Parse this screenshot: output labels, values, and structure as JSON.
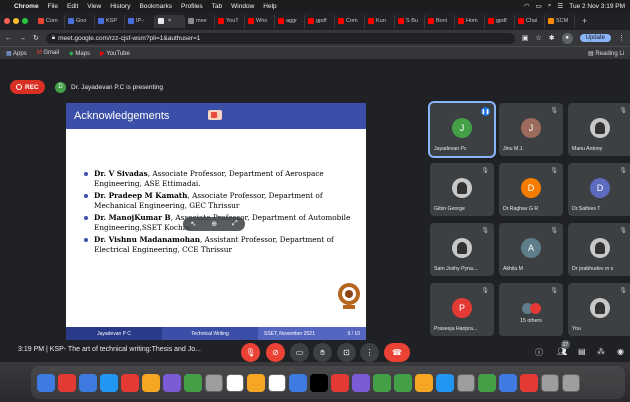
{
  "menubar": {
    "apple": "",
    "app": "Chrome",
    "items": [
      "File",
      "Edit",
      "View",
      "History",
      "Bookmarks",
      "Profiles",
      "Tab",
      "Window",
      "Help"
    ],
    "clock": "Tue 2 Nov  3:19 PM"
  },
  "tabs": [
    {
      "label": "Com",
      "color": "#ea4335"
    },
    {
      "label": "Goo",
      "color": "#4a6ee0"
    },
    {
      "label": "KSP",
      "color": "#4a6ee0"
    },
    {
      "label": "IP-:",
      "color": "#4a6ee0"
    },
    {
      "label": "",
      "color": "#e8eaed",
      "active": true
    },
    {
      "label": "mee",
      "color": "#888"
    },
    {
      "label": "YouT",
      "color": "#ff0000"
    },
    {
      "label": "Who",
      "color": "#ff0000"
    },
    {
      "label": "aggr",
      "color": "#ff0000"
    },
    {
      "label": "gpdf",
      "color": "#ff0000"
    },
    {
      "label": "Com",
      "color": "#ff0000"
    },
    {
      "label": "Kun",
      "color": "#ff0000"
    },
    {
      "label": "S Bu",
      "color": "#ff0000"
    },
    {
      "label": "Boni",
      "color": "#ff0000"
    },
    {
      "label": "Hom",
      "color": "#ff0000"
    },
    {
      "label": "gpdf",
      "color": "#ff0000"
    },
    {
      "label": "Chai",
      "color": "#ff0000"
    },
    {
      "label": "SCM",
      "color": "#ff8c00"
    }
  ],
  "address": {
    "url": "meet.google.com/rzz-cjsf-wsm?pli=1&authuser=1",
    "update_label": "Update"
  },
  "bookmarks": {
    "items": [
      "Apps",
      "Gmail",
      "Maps",
      "YouTube"
    ],
    "reading_list": "Reading Li"
  },
  "meet": {
    "rec_label": "REC",
    "presenter_initial": "D",
    "presenter_text": "Dr. Jayadevan P.C is presenting",
    "meeting_info": "3:19 PM  |  KSP- The art of technical writing:Thesis and Jo...",
    "people_badge": "27"
  },
  "slide": {
    "title": "Acknowledgements",
    "items": [
      {
        "name": "Dr. V Sivadas",
        "rest": ", Associate Professor, Department of Aerospace Engineering, ASE Ettimadai."
      },
      {
        "name": "Dr. Pradeep M Kamath",
        "rest": ", Associate Professor, Department of Mechanical Engineering, GEC Thrissur"
      },
      {
        "name": "Dr. ManojKumar B",
        "rest": ", Associate Professor, Department of Automobile Engineering,SSET Kochin."
      },
      {
        "name": "Dr. Vishnu Madanamohan",
        "rest": ", Assistant Professor, Department of Electrical Engineering, CCE Thrissur"
      }
    ],
    "footer": [
      "Jayadevan P C",
      "Technical Writing",
      "SSET, November 2021",
      "9 / 10"
    ]
  },
  "participants": [
    {
      "name": "Jayadevan Pc",
      "initial": "J",
      "color": "#43a047",
      "active": true
    },
    {
      "name": "Jinu M.J.",
      "initial": "J",
      "color": "#9c6b5e"
    },
    {
      "name": "Manu Antony",
      "initial": "",
      "color": "photo"
    },
    {
      "name": "Gibin George",
      "initial": "",
      "color": "photo"
    },
    {
      "name": "Dr.Raghav G R",
      "initial": "D",
      "color": "#f57c00"
    },
    {
      "name": "Dr.Sathies T",
      "initial": "D",
      "color": "#5c6bc0"
    },
    {
      "name": "Sam Joshy Pyna...",
      "initial": "",
      "color": "photo"
    },
    {
      "name": "Akhila M",
      "initial": "A",
      "color": "#607d8b"
    },
    {
      "name": "Dr prabhudev m s",
      "initial": "",
      "color": "photo"
    },
    {
      "name": "Praseeja Haripra...",
      "initial": "P",
      "color": "#e53935"
    },
    {
      "name": "15 others",
      "initial": "A",
      "color": "#607d8b"
    },
    {
      "name": "You",
      "initial": "",
      "color": "photo"
    }
  ],
  "dock_colors": [
    "#3d7be0",
    "#e53935",
    "#3d7be0",
    "#2196f3",
    "#e53935",
    "#f5a623",
    "#7b5cd6",
    "#43a047",
    "#9e9e9e",
    "#ffffff",
    "#f5a623",
    "#ffffff",
    "#3d7be0",
    "#000000",
    "#e53935",
    "#7b5cd6",
    "#43a047",
    "#43a047",
    "#f5a623",
    "#2196f3",
    "#9e9e9e",
    "#43a047",
    "#3d7be0",
    "#e53935",
    "#9e9e9e",
    "#9e9e9e"
  ]
}
